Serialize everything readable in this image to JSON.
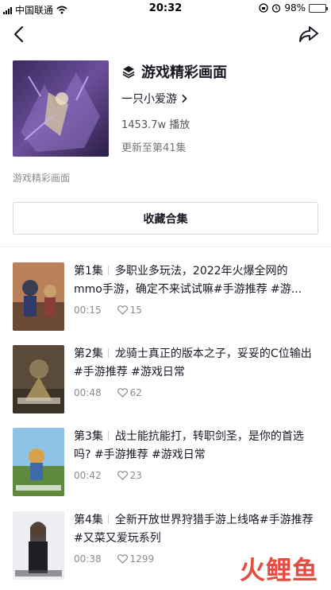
{
  "status_bar": {
    "carrier": "中国联通",
    "time": "20:32",
    "battery": "98%",
    "battery_level": 0.98
  },
  "nav": {
    "back_icon": "back-arrow-icon",
    "share_icon": "share-arrow-icon"
  },
  "collection": {
    "title": "游戏精彩画面",
    "title_icon": "layers-icon",
    "author": "一只小爱游",
    "plays": "1453.7w 播放",
    "updated": "更新至第41集",
    "description": "游戏精彩画面",
    "collect_button": "收藏合集"
  },
  "episodes": [
    {
      "number": "第1集",
      "title": "多职业多玩法，2022年火爆全网的mmo手游，确定不来试试嘛#手游推荐 #游...",
      "duration": "00:15",
      "likes": "15"
    },
    {
      "number": "第2集",
      "title": "龙骑士真正的版本之子，妥妥的C位输出#手游推荐 #游戏日常",
      "duration": "00:48",
      "likes": "62"
    },
    {
      "number": "第3集",
      "title": "战士能抗能打，转职剑圣，是你的首选吗? #手游推荐 #游戏日常",
      "duration": "00:42",
      "likes": "23"
    },
    {
      "number": "第4集",
      "title": "全新开放世界狩猎手游上线咯#手游推荐 #又菜又爱玩系列",
      "duration": "00:38",
      "likes": "1299"
    }
  ],
  "watermark": "火鲤鱼",
  "colors": {
    "text_primary": "#161823",
    "text_secondary": "#8a8b91",
    "accent_watermark": "#e23a2e",
    "battery_green": "#4cd964"
  }
}
